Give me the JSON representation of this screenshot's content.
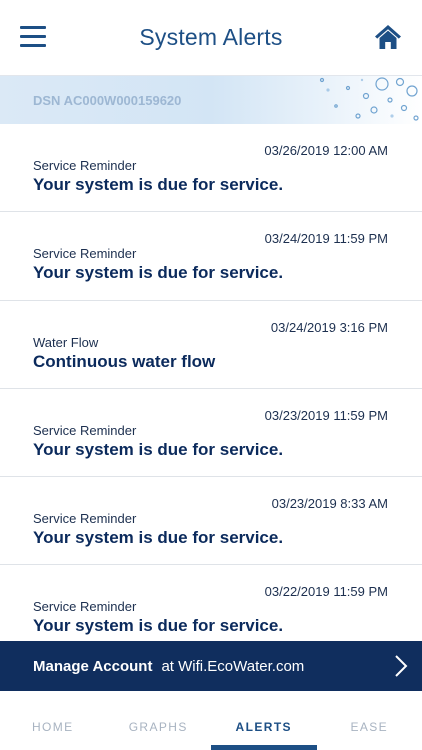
{
  "header": {
    "title": "System Alerts"
  },
  "device": {
    "dsn": "DSN AC000W000159620"
  },
  "alerts": [
    {
      "timestamp": "03/26/2019 12:00 AM",
      "type": "Service Reminder",
      "message": "Your system is due for service."
    },
    {
      "timestamp": "03/24/2019 11:59 PM",
      "type": "Service Reminder",
      "message": "Your system is due for service."
    },
    {
      "timestamp": "03/24/2019 3:16 PM",
      "type": "Water Flow",
      "message": "Continuous water flow"
    },
    {
      "timestamp": "03/23/2019 11:59 PM",
      "type": "Service Reminder",
      "message": "Your system is due for service."
    },
    {
      "timestamp": "03/23/2019 8:33 AM",
      "type": "Service Reminder",
      "message": "Your system is due for service."
    },
    {
      "timestamp": "03/22/2019 11:59 PM",
      "type": "Service Reminder",
      "message": "Your system is due for service."
    }
  ],
  "manage": {
    "label": "Manage Account",
    "url": "at Wifi.EcoWater.com"
  },
  "tabs": [
    {
      "label": "HOME"
    },
    {
      "label": "GRAPHS"
    },
    {
      "label": "ALERTS"
    },
    {
      "label": "EASE"
    }
  ],
  "icons": {
    "menu": "hamburger-menu-icon",
    "home": "home-icon",
    "chevron": "chevron-right-icon",
    "decoration": "water-bubbles-icon"
  },
  "colors": {
    "brand": "#1d4f85",
    "manage_bar": "#102e5e",
    "tab_inactive": "#a8b3c1"
  }
}
